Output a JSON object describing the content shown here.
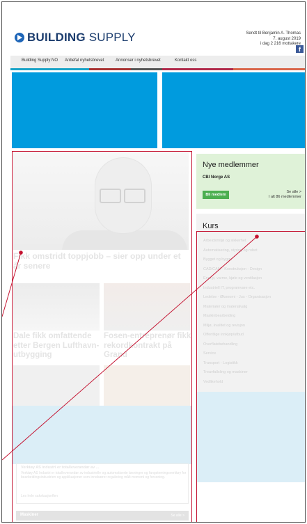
{
  "brand": {
    "name_bold": "BUILDING",
    "name_light": " SUPPLY"
  },
  "header_meta": {
    "line1": "Sendt til Benjamin A. Thomas",
    "line2": "7. august 2019",
    "line3": "i dag 2 216 mottakere"
  },
  "nav": {
    "items": [
      "Building Supply NO",
      "Anbefal nyhetsbrevet",
      "Annonser i nyhetsbrevet",
      "Kontakt oss"
    ],
    "facebook_icon": "facebook-icon"
  },
  "colors": {
    "banner": "#009bde",
    "bars": [
      "#1aa3c7",
      "#a83232",
      "#555555",
      "#b0294a",
      "#d9664a"
    ],
    "highlight_box": "#c41230"
  },
  "lead_story": {
    "title": "Fikk omstridt toppjobb – sier opp under et år senere"
  },
  "stories": [
    {
      "title": "Dale fikk omfattende etter Bergen Lufthavn-utbygging"
    },
    {
      "title": "Fosen-entreprenør fikk rekordkontrakt på Grand"
    }
  ],
  "new_members": {
    "heading": "Nye medlemmer",
    "company": "CBI Norge AS",
    "button": "Bli medlem",
    "see_all": "Se alle >",
    "total": "I alt 86 medlemmer"
  },
  "courses": {
    "heading": "Kurs",
    "items": [
      "Arbeidsmiljø og sikkerhet",
      "Automatisering, styring og robot",
      "Bygget og bygge",
      "CAD/CAM - Konstruksjon - Design",
      "Energi, varme, kjøle og ventilasjon",
      "Industriell IT, programvare etc.",
      "Ledelse - Økonomi - Jus - Organisasjon",
      "Materialer og materialvalg",
      "Maskinbearbeiding",
      "Miljø, kvalitet og revisjon",
      "Offentlige innkjøp/utbud",
      "Overflatebehandling",
      "Service",
      "Transport - Logistikk",
      "Treavfallsling og maskiner",
      "Vedlikehold"
    ]
  },
  "article": {
    "title": "Verktøy AS industri er totalleverandør av ...",
    "body": "Verktøy AS Industri er totalleverandør av industrielle og automatiserte løsninger og fangstemingsverktøy for bearbeidingsindustrien og applikasjoner som innebærer regulering målt moment og forsoning.",
    "link": "Les hele sakskasjonflen"
  },
  "section": {
    "title": "Maskiner",
    "link": "Se alle >"
  }
}
